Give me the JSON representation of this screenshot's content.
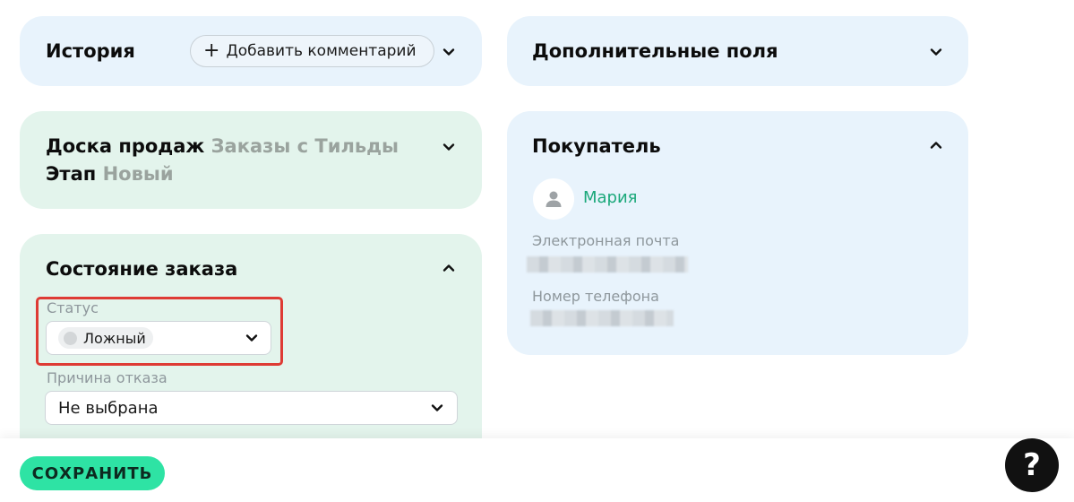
{
  "history": {
    "title": "История",
    "add_comment_label": "Добавить комментарий",
    "plus_icon": "plus-icon",
    "chevron": "chevron-down-icon"
  },
  "extra_fields": {
    "title": "Дополнительные поля",
    "chevron": "chevron-down-icon"
  },
  "sales_board": {
    "board_label": "Доска продаж",
    "board_value": "Заказы с Тильды",
    "stage_label": "Этап",
    "stage_value": "Новый",
    "chevron": "chevron-down-icon"
  },
  "buyer": {
    "title": "Покупатель",
    "name": "Мария",
    "email_label": "Электронная почта",
    "phone_label": "Номер телефона",
    "chevron": "chevron-up-icon",
    "avatar_icon": "user-icon"
  },
  "order_state": {
    "title": "Состояние заказа",
    "status_label": "Статус",
    "status_value": "Ложный",
    "reject_reason_label": "Причина отказа",
    "reject_reason_value": "Не выбрана",
    "chevron": "chevron-up-icon"
  },
  "footer": {
    "save_label": "СОХРАНИТЬ",
    "help_label": "?"
  },
  "colors": {
    "accent_green": "#2ee3a4",
    "link_green": "#1ba87a",
    "highlight_red": "#de3b34",
    "card_blue": "#e8f3fc",
    "card_green": "#e3f4ec"
  }
}
